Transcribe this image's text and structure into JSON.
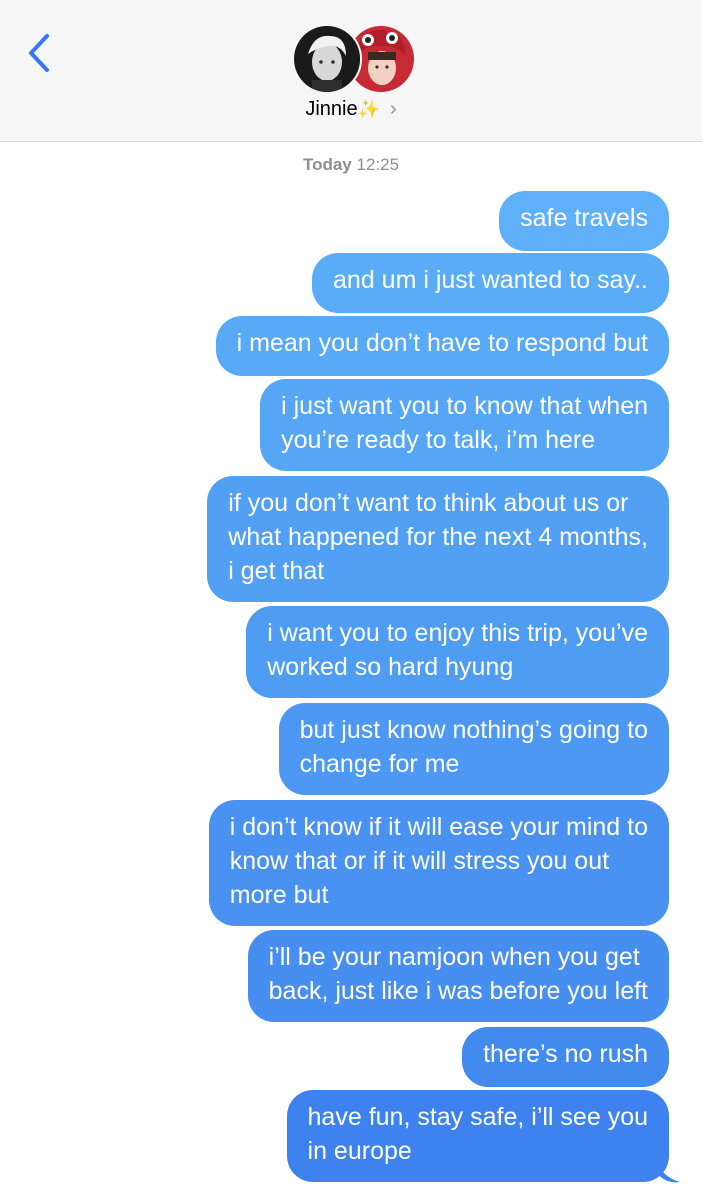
{
  "header": {
    "back_icon": "chevron-left-icon",
    "contact_name": "Jinnie",
    "contact_emoji": "✨",
    "chevron": "›",
    "accent": "#3478f6"
  },
  "thread": {
    "timestamp_day": "Today",
    "timestamp_time": "12:25",
    "messages": [
      {
        "text": "safe travels",
        "color": "#5fb0f8"
      },
      {
        "text": "and um i just wanted to say..",
        "color": "#5aacf7"
      },
      {
        "text": "i mean you don’t have to respond but",
        "color": "#58a9f6"
      },
      {
        "text": "i just want you to know that when\nyou’re ready to talk, i’m here",
        "color": "#56a6f5"
      },
      {
        "text": "if you don’t want to think about us or\nwhat happened for the next 4 months,\ni get that",
        "color": "#52a0f4"
      },
      {
        "text": "i want you to enjoy this trip, you’ve\nworked so hard hyung",
        "color": "#4f9cf3"
      },
      {
        "text": "but just know nothing’s going to\nchange for me",
        "color": "#4c98f2"
      },
      {
        "text": "i don’t know if it will ease your mind to\nknow that or if it will stress you out\nmore but",
        "color": "#4992f1"
      },
      {
        "text": "i’ll be your namjoon when you get\nback, just like i was before you left",
        "color": "#468ef0"
      },
      {
        "text": "there’s no rush",
        "color": "#438aef"
      },
      {
        "text": "have fun, stay safe, i’ll see you\nin europe",
        "color": "#3d82ee"
      }
    ]
  }
}
